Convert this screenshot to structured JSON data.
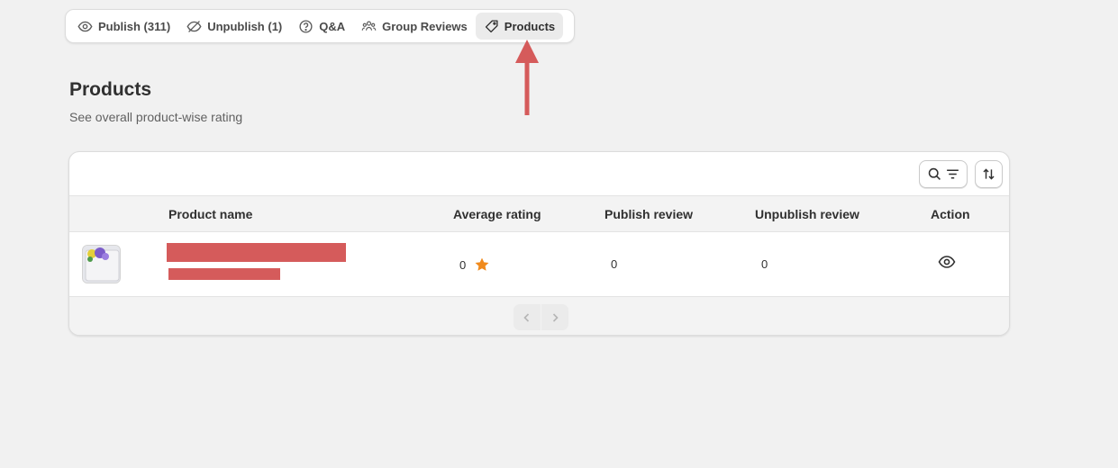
{
  "tabs": [
    {
      "label": "Publish (311)",
      "icon": "eye-icon",
      "active": false
    },
    {
      "label": "Unpublish (1)",
      "icon": "eye-off-icon",
      "active": false
    },
    {
      "label": "Q&A",
      "icon": "question-icon",
      "active": false
    },
    {
      "label": "Group Reviews",
      "icon": "people-icon",
      "active": false
    },
    {
      "label": "Products",
      "icon": "tag-icon",
      "active": true
    }
  ],
  "page": {
    "title": "Products",
    "subtitle": "See overall product-wise rating"
  },
  "table": {
    "columns": [
      "Product name",
      "Average rating",
      "Publish review",
      "Unpublish review",
      "Action"
    ],
    "rows": [
      {
        "average_rating": "0",
        "publish_review": "0",
        "unpublish_review": "0"
      }
    ]
  },
  "colors": {
    "accent_arrow": "#d55b5b",
    "star": "#f08a1c",
    "redaction": "#d55b5b"
  }
}
